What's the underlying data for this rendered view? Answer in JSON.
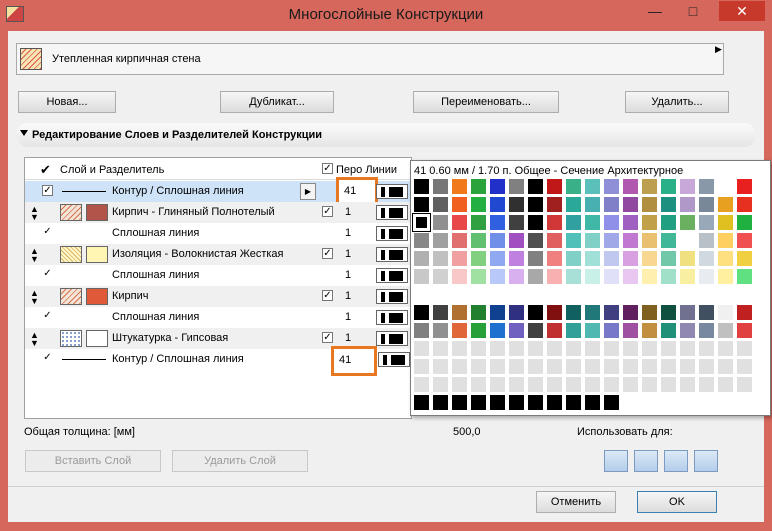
{
  "window": {
    "title": "Многослойные Конструкции",
    "min": "—",
    "max": "□",
    "close": "✕"
  },
  "combo": {
    "value": "Утепленная кирпичная стена"
  },
  "buttons": {
    "new": "Новая...",
    "duplicate": "Дубликат...",
    "rename": "Переименовать...",
    "delete": "Удалить..."
  },
  "section": {
    "title": "Редактирование Слоев и Разделителей Конструкции"
  },
  "table": {
    "col_layer": "Слой и Разделитель",
    "col_pen": "Перо Линии",
    "rows": [
      {
        "type": "sep",
        "name": "Контур / Сплошная линия",
        "pen": "41"
      },
      {
        "type": "layer",
        "name": "Кирпич - Глиняный Полнотелый",
        "pen": "1",
        "color": "#b3544a",
        "hatch": "brick"
      },
      {
        "type": "sep",
        "name": "Сплошная линия",
        "pen": "1"
      },
      {
        "type": "layer",
        "name": "Изоляция - Волокнистая Жесткая",
        "pen": "1",
        "color": "#fff6b4",
        "hatch": "insul"
      },
      {
        "type": "sep",
        "name": "Сплошная линия",
        "pen": "1"
      },
      {
        "type": "layer",
        "name": "Кирпич",
        "pen": "1",
        "color": "#e05a3a",
        "hatch": "brick"
      },
      {
        "type": "sep",
        "name": "Сплошная линия",
        "pen": "1"
      },
      {
        "type": "layer",
        "name": "Штукатурка - Гипсовая",
        "pen": "1",
        "color": "#ffffff",
        "hatch": "dots"
      },
      {
        "type": "sep",
        "name": "Контур / Сплошная линия",
        "pen": "41"
      }
    ]
  },
  "total": {
    "label": "Общая толщина: [мм]",
    "value": "500,0"
  },
  "layer_buttons": {
    "insert": "Вставить Слой",
    "remove": "Удалить Слой"
  },
  "use_for": {
    "label": "Использовать для:"
  },
  "footer": {
    "cancel": "Отменить",
    "ok": "OK"
  },
  "palette": {
    "header": "41  0.60 мм /  1.70 п. Общее - Сечение Архитектурное",
    "rows": [
      [
        "#000000",
        "#777777",
        "#f07a1a",
        "#2aa43a",
        "#2030c8",
        "#808080",
        "#000000",
        "#c01818",
        "#3ab088",
        "#5cc0ba",
        "#8f8fd8",
        "#b058b0",
        "#bca050",
        "#2ab088",
        "#c8a8d8",
        "#8898a8",
        "#ffffff",
        "#e82020"
      ],
      [
        "#000000",
        "#606060",
        "#f06020",
        "#24b040",
        "#2048d0",
        "#303030",
        "#000000",
        "#a02020",
        "#2aa898",
        "#48b0b0",
        "#8080c8",
        "#9048a0",
        "#b09040",
        "#1e9080",
        "#b098c8",
        "#788898",
        "#e8a020",
        "#e83020"
      ],
      [
        "#000000",
        "#909090",
        "#e84848",
        "#30a040",
        "#3060e0",
        "#404040",
        "#000000",
        "#d03838",
        "#30a0a0",
        "#40b8a8",
        "#9090e8",
        "#a060c0",
        "#c0a048",
        "#20a080",
        "#6ab060",
        "#98a8b8",
        "#e0c020",
        "#20b040"
      ],
      [
        "#888888",
        "#a0a0a0",
        "#e07070",
        "#60c070",
        "#7090e8",
        "#a050c0",
        "#505050",
        "#e06060",
        "#50c0b8",
        "#80d0c8",
        "#a0a8e8",
        "#c078d0",
        "#e8c070",
        "#40b898",
        "#ffffff",
        "#b8c0c8",
        "#ffd060",
        "#f05050"
      ],
      [
        "#b0b0b0",
        "#c0c0c0",
        "#f0a0a0",
        "#80d080",
        "#90a8f0",
        "#c080e0",
        "#808080",
        "#f08080",
        "#80d0c8",
        "#a0e0d8",
        "#c0c8f0",
        "#d8a0e0",
        "#f8d890",
        "#70c8a8",
        "#f0e080",
        "#d0d8e0",
        "#ffe080",
        "#f0d040"
      ],
      [
        "#c8c8c8",
        "#d0d0d0",
        "#f8c8c8",
        "#a0e0a0",
        "#b8c8f8",
        "#d8b0f0",
        "#a8a8a8",
        "#f8b0b0",
        "#a8e0d8",
        "#c8f0e8",
        "#e0e0f8",
        "#e8c8f0",
        "#fff0b0",
        "#a0e0c8",
        "#f8f0a0",
        "#e8ecf0",
        "#fff0a0",
        "#60e080"
      ],
      [],
      [
        "#000000",
        "#404040",
        "#b07030",
        "#208030",
        "#104090",
        "#303080",
        "#000000",
        "#801010",
        "#106060",
        "#207878",
        "#404080",
        "#602060",
        "#806020",
        "#105040",
        "#707090",
        "#405060",
        "#f0f0f0",
        "#c02020"
      ],
      [
        "#808080",
        "#909090",
        "#e06838",
        "#28a038",
        "#2070d0",
        "#7060c0",
        "#404040",
        "#c03030",
        "#30a098",
        "#50b8b0",
        "#7878c8",
        "#a050a0",
        "#c09040",
        "#209078",
        "#9088b0",
        "#7888a0",
        "#c0c0c0",
        "#e04040"
      ],
      [
        "#e0e0e0",
        "#e0e0e0",
        "#e0e0e0",
        "#e0e0e0",
        "#e0e0e0",
        "#e0e0e0",
        "#e0e0e0",
        "#e0e0e0",
        "#e0e0e0",
        "#e0e0e0",
        "#e0e0e0",
        "#e0e0e0",
        "#e0e0e0",
        "#e0e0e0",
        "#e0e0e0",
        "#e0e0e0",
        "#e0e0e0",
        "#e0e0e0"
      ],
      [
        "#e0e0e0",
        "#e0e0e0",
        "#e0e0e0",
        "#e0e0e0",
        "#e0e0e0",
        "#e0e0e0",
        "#e0e0e0",
        "#e0e0e0",
        "#e0e0e0",
        "#e0e0e0",
        "#e0e0e0",
        "#e0e0e0",
        "#e0e0e0",
        "#e0e0e0",
        "#e0e0e0",
        "#e0e0e0",
        "#e0e0e0",
        "#e0e0e0"
      ],
      [
        "#e0e0e0",
        "#e0e0e0",
        "#e0e0e0",
        "#e0e0e0",
        "#e0e0e0",
        "#e0e0e0",
        "#e0e0e0",
        "#e0e0e0",
        "#e0e0e0",
        "#e0e0e0",
        "#e0e0e0",
        "#e0e0e0",
        "#e0e0e0",
        "#e0e0e0",
        "#e0e0e0",
        "#e0e0e0",
        "#e0e0e0",
        "#e0e0e0"
      ],
      [
        "#000000",
        "#000000",
        "#000000",
        "#000000",
        "#000000",
        "#000000",
        "#000000",
        "#000000",
        "#000000",
        "#000000",
        "#000000",
        "#ffffff",
        "#ffffff",
        "#ffffff",
        "#ffffff",
        "#ffffff",
        "#ffffff",
        "#ffffff"
      ]
    ]
  }
}
